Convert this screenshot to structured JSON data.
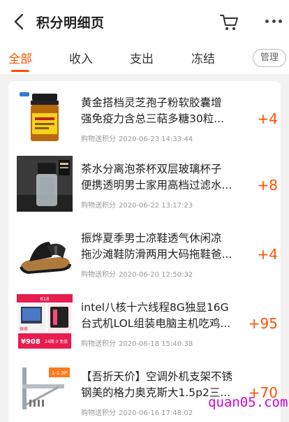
{
  "header": {
    "title": "积分明细页",
    "back_icon": "back-chevron-icon",
    "cart_icon": "cart-icon",
    "more_icon": "more-dots-icon"
  },
  "tabs": [
    {
      "label": "全部",
      "active": true
    },
    {
      "label": "收入",
      "active": false
    },
    {
      "label": "支出",
      "active": false
    },
    {
      "label": "冻结",
      "active": false
    }
  ],
  "manage_label": "管理",
  "colors": {
    "accent": "#ff5000",
    "watermark": "#d000d0"
  },
  "records": [
    {
      "name_line1": "黄金搭档灵芝孢子粉软胶囊增",
      "name_line2": "强免疫力含总三萜多糖30粒...",
      "source": "购物送积分",
      "time": "2020-06-23 14:33:44",
      "points": "+4",
      "thumb": "capsule-bottle-image"
    },
    {
      "name_line1": "茶水分离泡茶杯双层玻璃杯子",
      "name_line2": "便携透明男士家用高档过滤水...",
      "source": "购物送积分",
      "time": "2020-06-22 13:17:23",
      "points": "+8",
      "thumb": "glass-cup-image"
    },
    {
      "name_line1": "振烨夏季男士凉鞋透气休闲凉",
      "name_line2": "拖沙滩鞋防滑两用大码拖鞋爸...",
      "source": "购物送积分",
      "time": "2020-06-20 12:50:32",
      "points": "+4",
      "thumb": "sandal-image"
    },
    {
      "name_line1": "intel八核十六线程8G独显16G",
      "name_line2": "台式机LOL组装电脑主机吃鸡...",
      "source": "购物送积分",
      "time": "2020-06-18 15:40:38",
      "points": "+95",
      "thumb": "computer-ad-image",
      "thumb_text": {
        "ribbon": "618",
        "big": "¥908",
        "small": "24期 0 免息",
        "tag": "保修"
      }
    },
    {
      "name_line1": "【吾折天价】空调外机支架不锈",
      "name_line2": "钢美的格力奥克斯大1.5p2三...",
      "source": "购物送积分",
      "time": "2020-06-16 17:48:02",
      "points": "+70",
      "thumb": "bracket-image",
      "thumb_text": {
        "label": "1-1.5P"
      }
    }
  ],
  "watermark": "quan05.com"
}
